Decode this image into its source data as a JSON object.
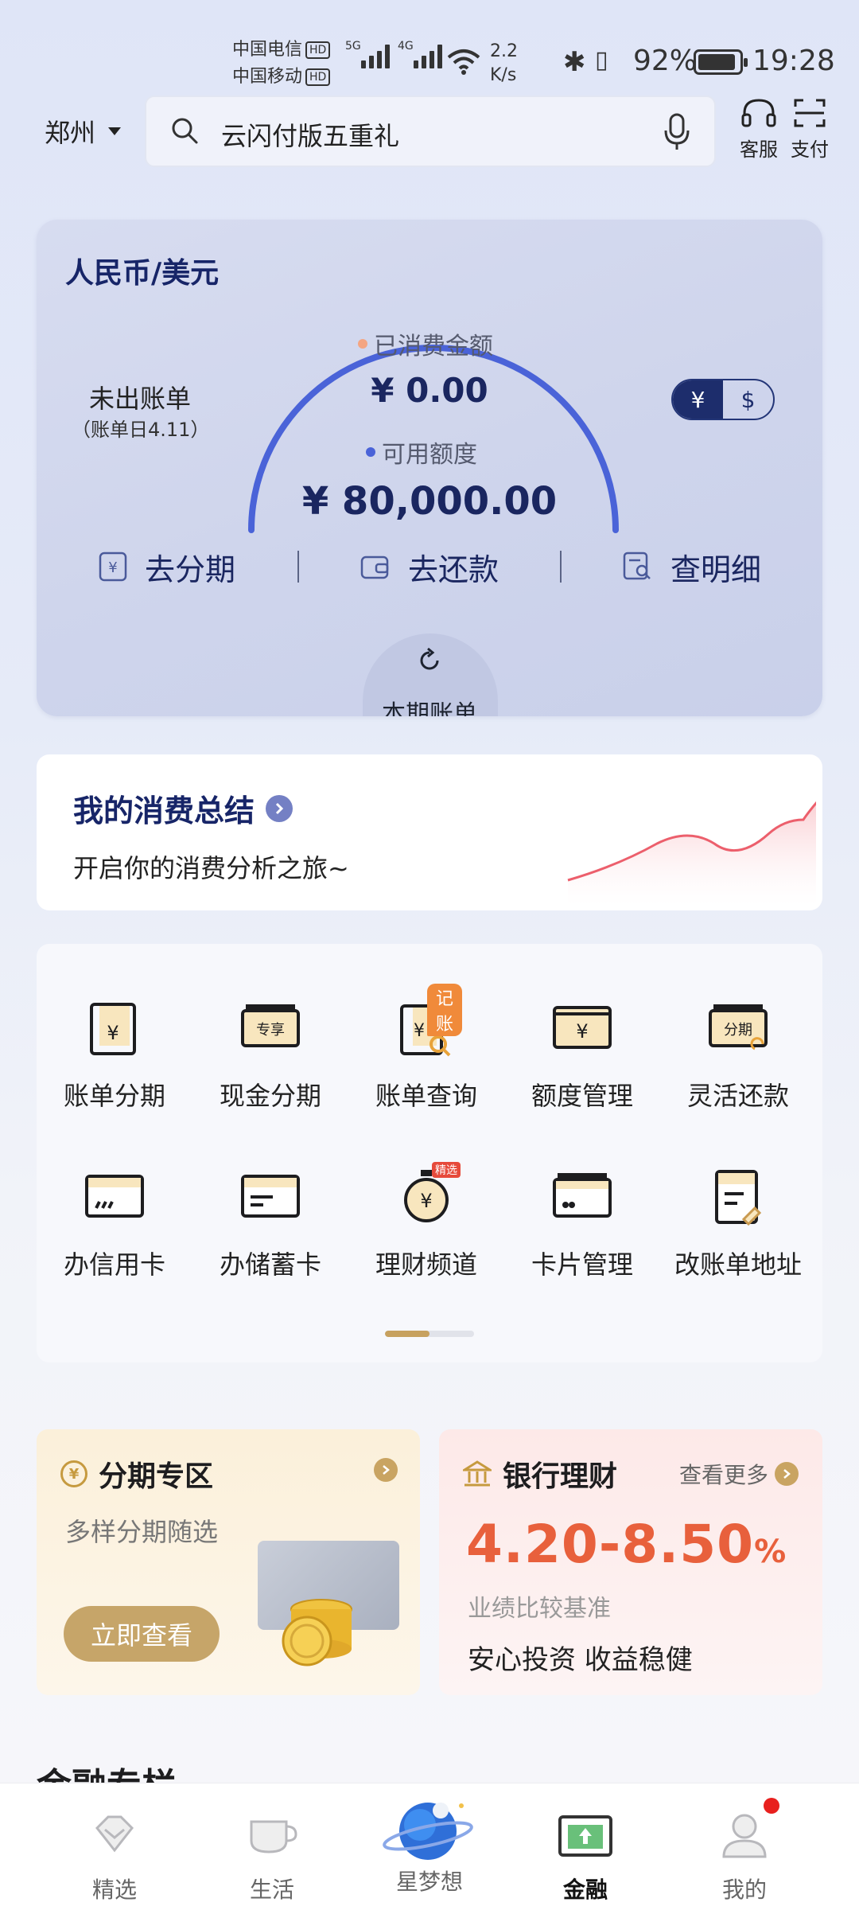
{
  "status_bar": {
    "carrier1": "中国电信",
    "carrier2": "中国移动",
    "hd": "HD",
    "net1": "5G",
    "net2": "4G",
    "speed_value": "2.2",
    "speed_unit": "K/s",
    "battery": "92%",
    "battery_level": 0.92,
    "time": "19:28"
  },
  "header": {
    "city": "郑州",
    "search_text": "云闪付版五重礼",
    "customer_service": "客服",
    "pay": "支付"
  },
  "credit_card": {
    "title": "人民币/美元",
    "unbilled_label": "未出账单",
    "bill_day": "（账单日4.11）",
    "spent_label": "已消费金额",
    "spent_value": "¥ 0.00",
    "available_label": "可用额度",
    "available_value": "¥ 80,000.00",
    "currency_cny": "¥",
    "currency_usd": "$",
    "actions": [
      "去分期",
      "去还款",
      "查明细"
    ],
    "current_bill": "本期账单",
    "colors": {
      "gauge": "#4a63d8",
      "spent_dot": "#f4a582",
      "available_dot": "#4a63d8",
      "title": "#172568"
    }
  },
  "consumption": {
    "title": "我的消费总结",
    "subtitle": "开启你的消费分析之旅~"
  },
  "services": {
    "items": [
      {
        "label": "账单分期",
        "icon": "bill-installment-icon"
      },
      {
        "label": "现金分期",
        "icon": "cash-installment-icon",
        "badge_text": "专享"
      },
      {
        "label": "账单查询",
        "icon": "bill-query-icon",
        "tag": "记账"
      },
      {
        "label": "额度管理",
        "icon": "limit-management-icon"
      },
      {
        "label": "灵活还款",
        "icon": "flexible-repayment-icon",
        "badge_text": "分期"
      },
      {
        "label": "办信用卡",
        "icon": "apply-credit-card-icon"
      },
      {
        "label": "办储蓄卡",
        "icon": "apply-debit-card-icon"
      },
      {
        "label": "理财频道",
        "icon": "wealth-channel-icon",
        "tag": "精选"
      },
      {
        "label": "卡片管理",
        "icon": "card-management-icon"
      },
      {
        "label": "改账单地址",
        "icon": "change-bill-address-icon"
      }
    ]
  },
  "promos": {
    "installment": {
      "title": "分期专区",
      "subtitle": "多样分期随选",
      "button": "立即查看",
      "coin_glyph": "¥"
    },
    "wealth": {
      "title": "银行理财",
      "more": "查看更多",
      "rate": "4.20-8.50",
      "rate_unit": "%",
      "benchmark": "业绩比较基准",
      "slogan": "安心投资 收益稳健",
      "accent": "#e8603c"
    }
  },
  "next_section_peek": "金融专栏",
  "bottom_nav": {
    "items": [
      {
        "label": "精选",
        "icon": "diamond-icon"
      },
      {
        "label": "生活",
        "icon": "cup-icon"
      },
      {
        "label": "星梦想",
        "icon": "planet-icon"
      },
      {
        "label": "金融",
        "icon": "finance-icon",
        "active": true
      },
      {
        "label": "我的",
        "icon": "person-icon",
        "has_dot": true
      }
    ]
  }
}
